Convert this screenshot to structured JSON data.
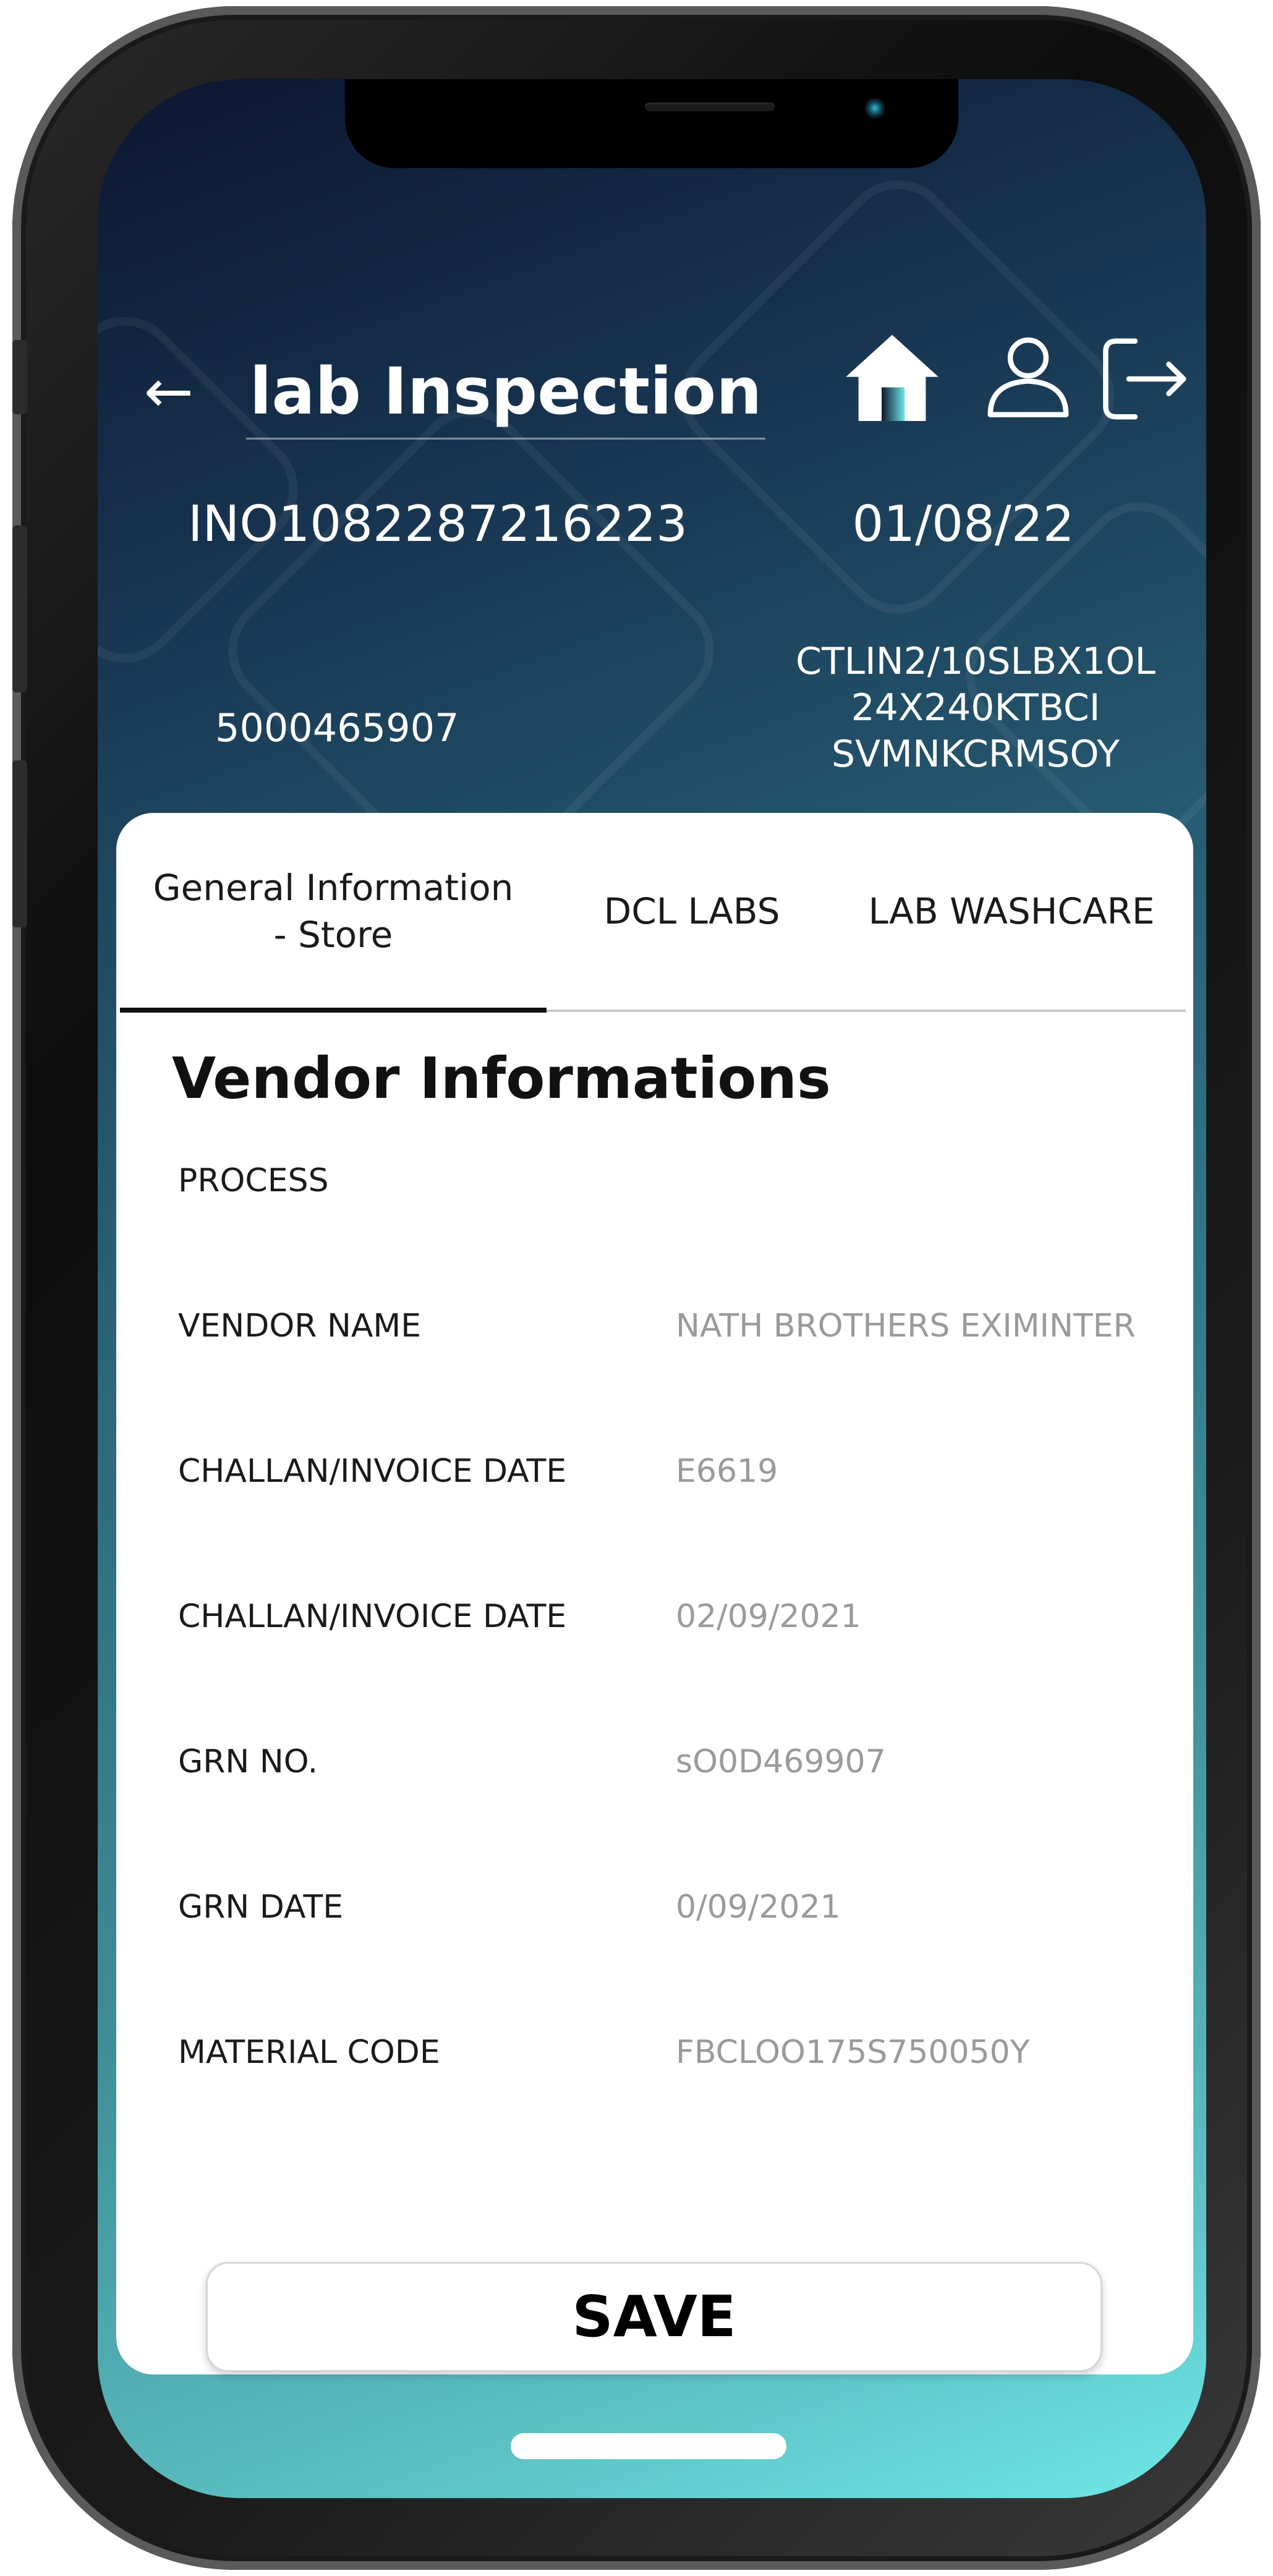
{
  "header": {
    "back_icon": "←",
    "title": "lab Inspection",
    "icons": [
      "home-icon",
      "user-icon",
      "logout-icon"
    ]
  },
  "info": {
    "inspection_no": "INO1082287216223",
    "date": "01/08/22",
    "po_number": "5000465907",
    "item_code": "CTLIN2/10SLBX1OL\n24X240KTBCI\nSVMNKCRMSOY"
  },
  "tabs": [
    {
      "label": "General Information\n- Store",
      "active": true
    },
    {
      "label": "DCL LABS",
      "active": false
    },
    {
      "label": "LAB WASHCARE",
      "active": false
    }
  ],
  "section": {
    "title": "Vendor Informations",
    "fields": [
      {
        "label": "PROCESS",
        "value": ""
      },
      {
        "label": "VENDOR NAME",
        "value": "NATH BROTHERS EXIMINTER"
      },
      {
        "label": "CHALLAN/INVOICE DATE",
        "value": "E6619"
      },
      {
        "label": "CHALLAN/INVOICE DATE",
        "value": "02/09/2021"
      },
      {
        "label": "GRN NO.",
        "value": "sO0D469907"
      },
      {
        "label": "GRN DATE",
        "value": "0/09/2021"
      },
      {
        "label": "MATERIAL CODE",
        "value": "FBCLOO175S750050Y"
      }
    ]
  },
  "actions": {
    "save_label": "SAVE"
  },
  "colors": {
    "gradient_top": "#0d1630",
    "gradient_bottom": "#6fe7e6",
    "value_text": "#9a9a9a"
  }
}
